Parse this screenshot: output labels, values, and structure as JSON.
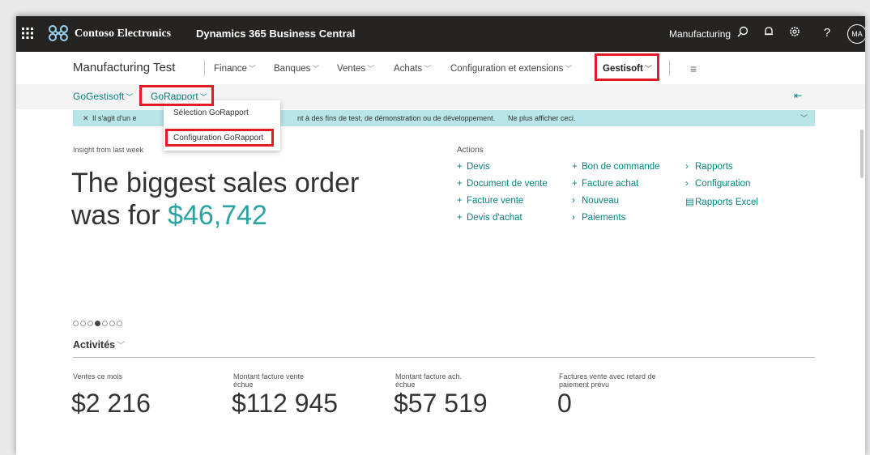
{
  "topbar": {
    "company_name": "Contoso Electronics",
    "product_name": "Dynamics 365 Business Central",
    "current_company": "Manufacturing",
    "avatar_initials": "MA"
  },
  "nav": {
    "role_center": "Manufacturing Test",
    "items": [
      "Finance",
      "Banques",
      "Ventes",
      "Achats",
      "Configuration et extensions",
      "Gestisoft"
    ]
  },
  "subnav": {
    "items": [
      "GoGestisoft",
      "GoRapport"
    ]
  },
  "dropdown": {
    "items": [
      "Sélection GoRapport",
      "Configuration GoRapport"
    ]
  },
  "infobar": {
    "message_start": "Il s'agit d'un e",
    "message_end": "nt à des fins de test, de démonstration ou de développement.",
    "dismiss_link": "Ne plus afficher ceci."
  },
  "headline": {
    "insight_label": "Insight from last week",
    "line1": "The biggest sales order",
    "line2_prefix": "was for ",
    "amount": "$46,742"
  },
  "actions": {
    "title": "Actions",
    "col1": [
      "Devis",
      "Document de vente",
      "Facture vente",
      "Devis d'achat"
    ],
    "col2": [
      "Bon de commande",
      "Facture achat",
      "Nouveau",
      "Paiements"
    ],
    "col3": [
      "Rapports",
      "Configuration",
      "Rapports Excel"
    ]
  },
  "pager": {
    "count": 7,
    "active_index": 3
  },
  "activities": {
    "title": "Activités",
    "tiles": [
      {
        "label": "Ventes ce mois",
        "value": "$2 216"
      },
      {
        "label": "Montant facture vente échue",
        "value": "$112 945"
      },
      {
        "label": "Montant facture ach. échue",
        "value": "$57 519"
      },
      {
        "label": "Factures vente avec retard de paiement prévu",
        "value": "0"
      }
    ]
  },
  "colors": {
    "accent": "#00857f",
    "highlight": "#e21b23",
    "topbar": "#252423",
    "info_bar": "#b8e5e7"
  }
}
